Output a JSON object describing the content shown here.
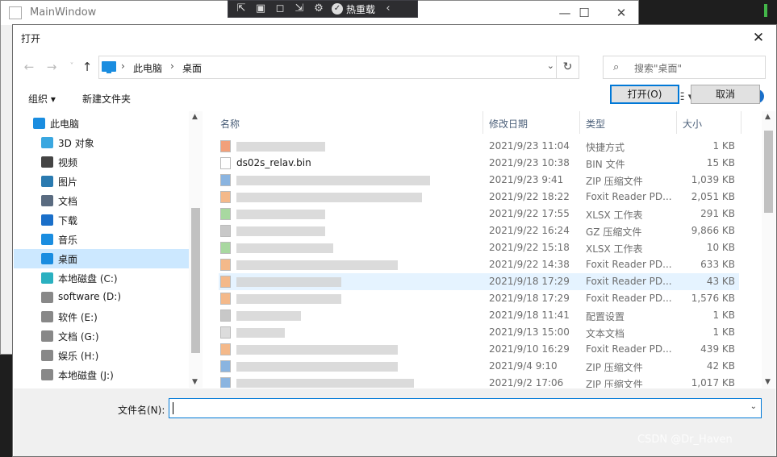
{
  "main_window": {
    "title": "MainWindow",
    "controls": [
      "—",
      "☐",
      "✕"
    ]
  },
  "debug_toolbar": {
    "hot_reload_label": "热重载"
  },
  "dialog": {
    "title": "打开",
    "close": "✕",
    "nav": {
      "back": "←",
      "forward": "→",
      "recent": "˅",
      "up": "↑"
    },
    "breadcrumb": [
      "此电脑",
      "桌面"
    ],
    "breadcrumb_sep": "›",
    "addr_drop": "⌄",
    "refresh": "↻",
    "search": {
      "placeholder": "搜索\"桌面\"",
      "icon": "⌕"
    },
    "toolbar": {
      "organize": "组织 ▾",
      "new_folder": "新建文件夹",
      "view": "☷ ▾",
      "help": "?"
    },
    "tree": [
      {
        "label": "此电脑",
        "icon": "pc-icon",
        "color": "#1a8de0",
        "indent": 24
      },
      {
        "label": "3D 对象",
        "icon": "3d-objects-icon",
        "color": "#3aa7e0",
        "indent": 34
      },
      {
        "label": "视频",
        "icon": "video-icon",
        "color": "#444",
        "indent": 34
      },
      {
        "label": "图片",
        "icon": "pictures-icon",
        "color": "#2a7ab0",
        "indent": 34
      },
      {
        "label": "文档",
        "icon": "documents-icon",
        "color": "#5a6b80",
        "indent": 34
      },
      {
        "label": "下载",
        "icon": "downloads-icon",
        "color": "#1a6fc9",
        "indent": 34
      },
      {
        "label": "音乐",
        "icon": "music-icon",
        "color": "#1a8de0",
        "indent": 34
      },
      {
        "label": "桌面",
        "icon": "desktop-icon",
        "color": "#1a8de0",
        "indent": 34,
        "selected": true
      },
      {
        "label": "本地磁盘 (C:)",
        "icon": "drive-c-icon",
        "color": "#2ab0c0",
        "indent": 34
      },
      {
        "label": "software (D:)",
        "icon": "drive-icon",
        "color": "#888",
        "indent": 34
      },
      {
        "label": "软件 (E:)",
        "icon": "drive-icon",
        "color": "#888",
        "indent": 34
      },
      {
        "label": "文档 (G:)",
        "icon": "drive-icon",
        "color": "#888",
        "indent": 34
      },
      {
        "label": "娱乐 (H:)",
        "icon": "drive-icon",
        "color": "#888",
        "indent": 34
      },
      {
        "label": "本地磁盘 (J:)",
        "icon": "drive-icon",
        "color": "#888",
        "indent": 34
      }
    ],
    "columns": [
      "名称",
      "修改日期",
      "类型",
      "大小"
    ],
    "files": [
      {
        "name": "",
        "date": "2021/9/23 11:04",
        "type": "快捷方式",
        "size": "1 KB",
        "icon_color": "#f2a07a",
        "blur": 110
      },
      {
        "name": "ds02s_relav.bin",
        "date": "2021/9/23 10:38",
        "type": "BIN 文件",
        "size": "15 KB",
        "icon_color": "#ffffff",
        "blur": 0
      },
      {
        "name": "",
        "date": "2021/9/23 9:41",
        "type": "ZIP 压缩文件",
        "size": "1,039 KB",
        "icon_color": "#8ab4e0",
        "blur": 240
      },
      {
        "name": "",
        "date": "2021/9/22 18:22",
        "type": "Foxit Reader PD...",
        "size": "2,051 KB",
        "icon_color": "#f4b98a",
        "blur": 230
      },
      {
        "name": "",
        "date": "2021/9/22 17:55",
        "type": "XLSX 工作表",
        "size": "291 KB",
        "icon_color": "#a8d8a0",
        "blur": 110
      },
      {
        "name": "",
        "date": "2021/9/22 16:24",
        "type": "GZ 压缩文件",
        "size": "9,866 KB",
        "icon_color": "#c8c8c8",
        "blur": 110
      },
      {
        "name": "",
        "date": "2021/9/22 15:18",
        "type": "XLSX 工作表",
        "size": "10 KB",
        "icon_color": "#a8d8a0",
        "blur": 120
      },
      {
        "name": "",
        "date": "2021/9/22 14:38",
        "type": "Foxit Reader PD...",
        "size": "633 KB",
        "icon_color": "#f4b98a",
        "blur": 200
      },
      {
        "name": "",
        "date": "2021/9/18 17:29",
        "type": "Foxit Reader PD...",
        "size": "43 KB",
        "icon_color": "#f4b98a",
        "blur": 130,
        "highlight": true
      },
      {
        "name": "",
        "date": "2021/9/18 17:29",
        "type": "Foxit Reader PD...",
        "size": "1,576 KB",
        "icon_color": "#f4b98a",
        "blur": 130
      },
      {
        "name": "",
        "date": "2021/9/18 11:41",
        "type": "配置设置",
        "size": "1 KB",
        "icon_color": "#c8c8c8",
        "blur": 80
      },
      {
        "name": "",
        "date": "2021/9/13 15:00",
        "type": "文本文档",
        "size": "1 KB",
        "icon_color": "#dcdcdc",
        "blur": 60
      },
      {
        "name": "",
        "date": "2021/9/10 16:29",
        "type": "Foxit Reader PD...",
        "size": "439 KB",
        "icon_color": "#f4b98a",
        "blur": 200
      },
      {
        "name": "",
        "date": "2021/9/4 9:10",
        "type": "ZIP 压缩文件",
        "size": "42 KB",
        "icon_color": "#8ab4e0",
        "blur": 200
      },
      {
        "name": "",
        "date": "2021/9/2 17:06",
        "type": "ZIP 压缩文件",
        "size": "1,017 KB",
        "icon_color": "#8ab4e0",
        "blur": 220
      }
    ],
    "filename": {
      "label": "文件名(N):",
      "value": ""
    },
    "buttons": {
      "open": "打开(O)",
      "cancel": "取消"
    }
  },
  "watermark": "CSDN @Dr_Haven"
}
